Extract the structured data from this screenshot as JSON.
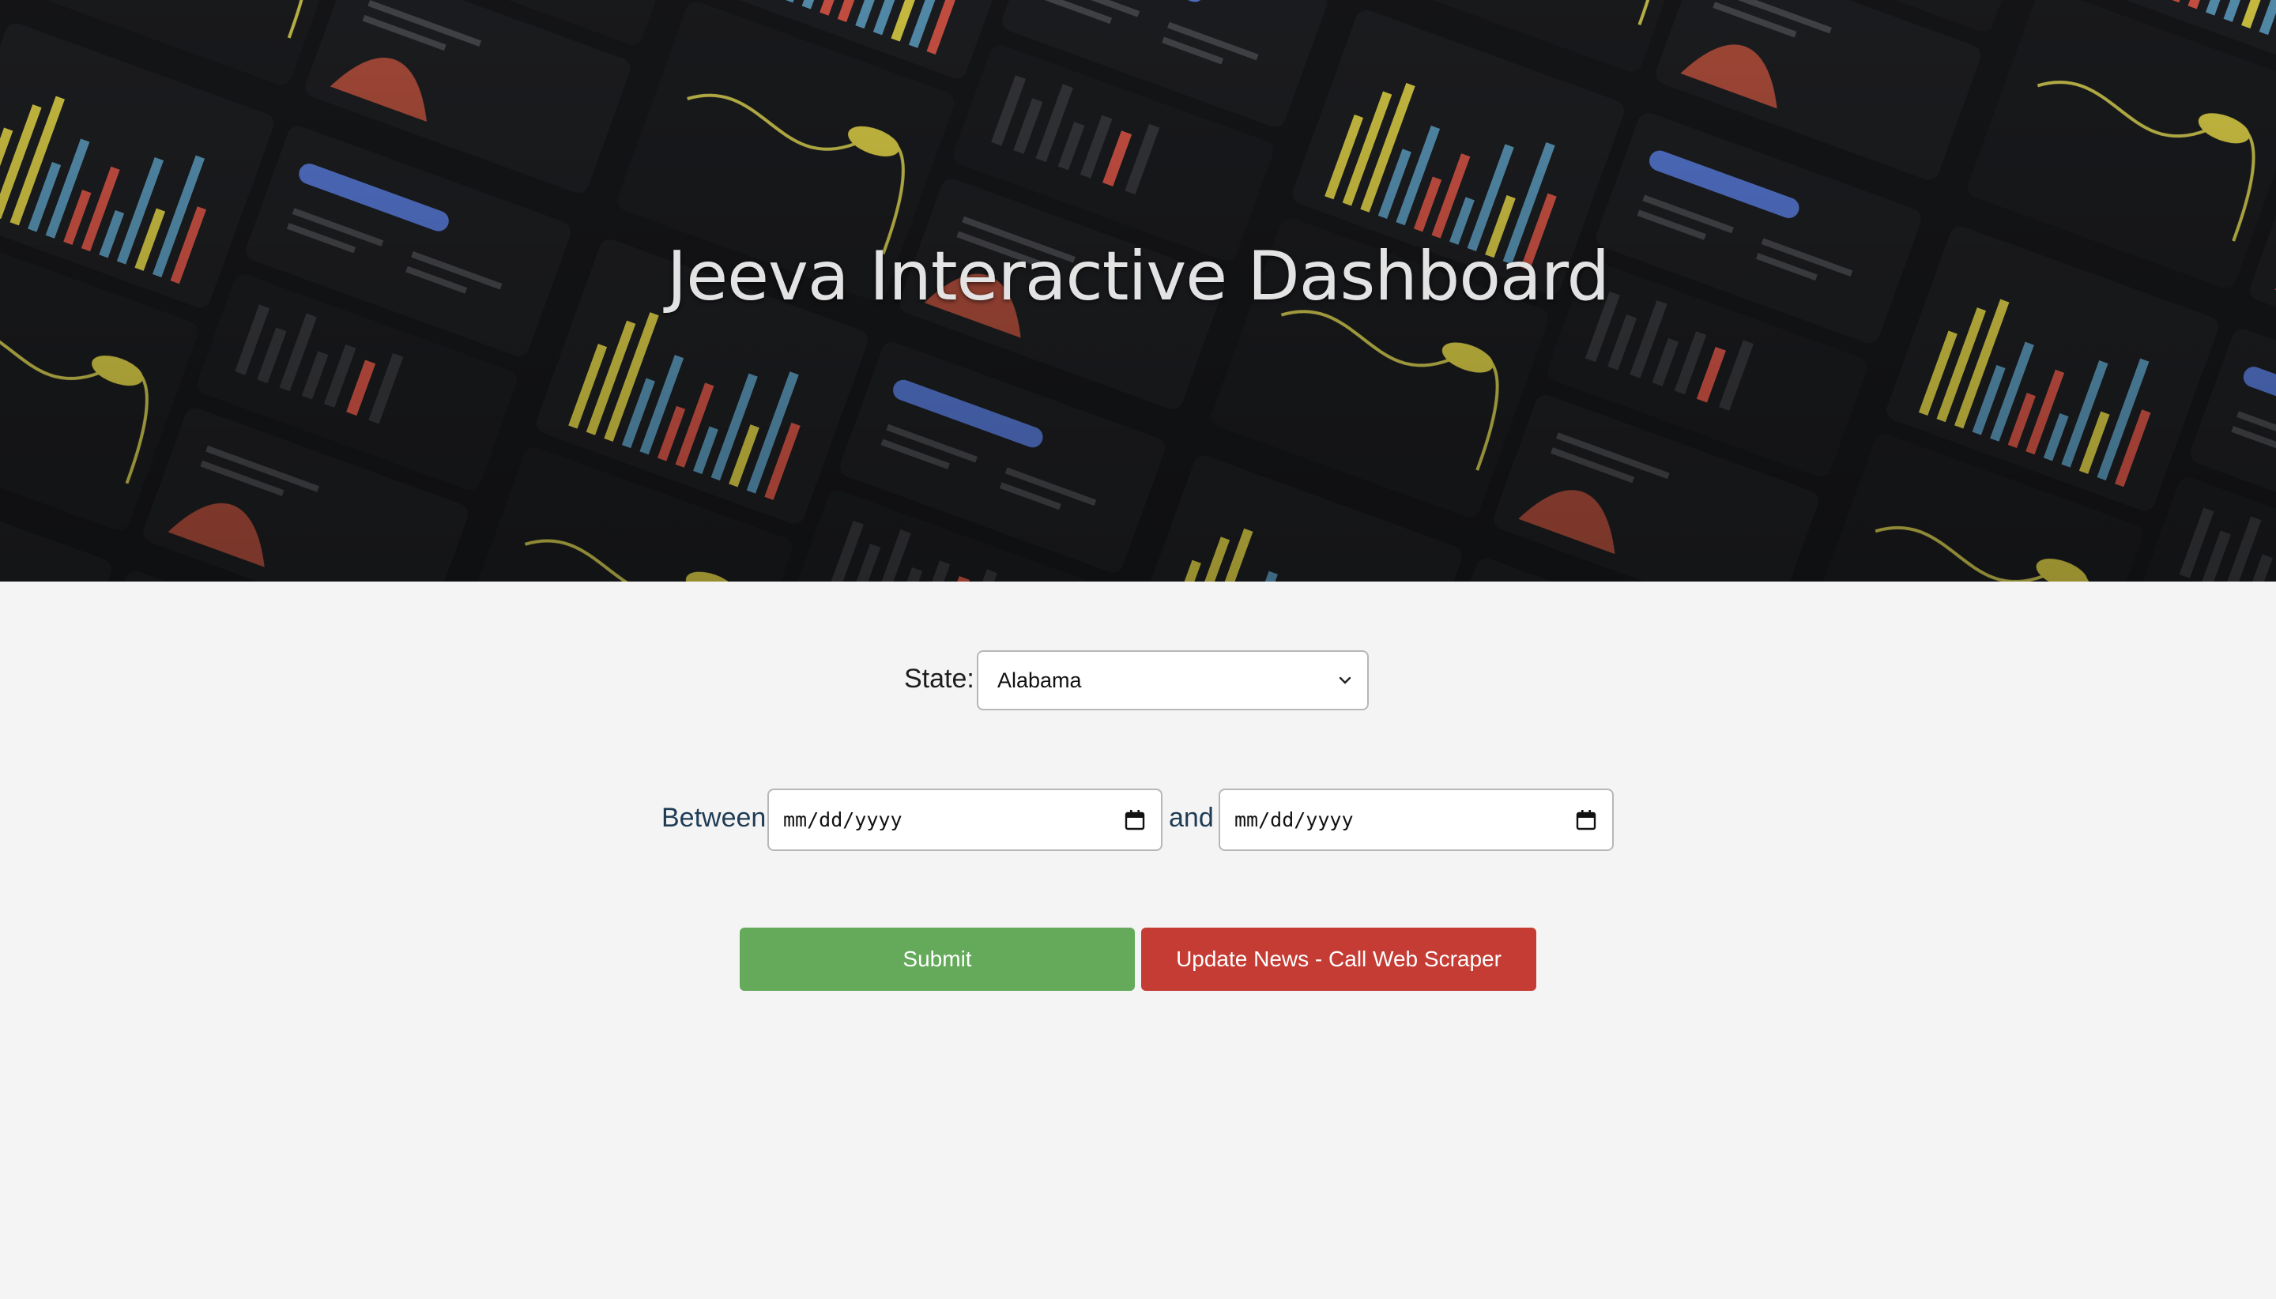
{
  "header": {
    "title": "Jeeva Interactive Dashboard"
  },
  "form": {
    "state_label": "State:",
    "state_selected": "Alabama",
    "between_label": "Between",
    "and_label": "and",
    "start_date_placeholder": "mm/dd/yyyy",
    "end_date_placeholder": "mm/dd/yyyy"
  },
  "buttons": {
    "submit_label": "Submit",
    "update_news_label": "Update News - Call Web Scraper"
  },
  "colors": {
    "submit": "#64aa5a",
    "update_news": "#c43c34",
    "hero_bg": "#151618"
  }
}
